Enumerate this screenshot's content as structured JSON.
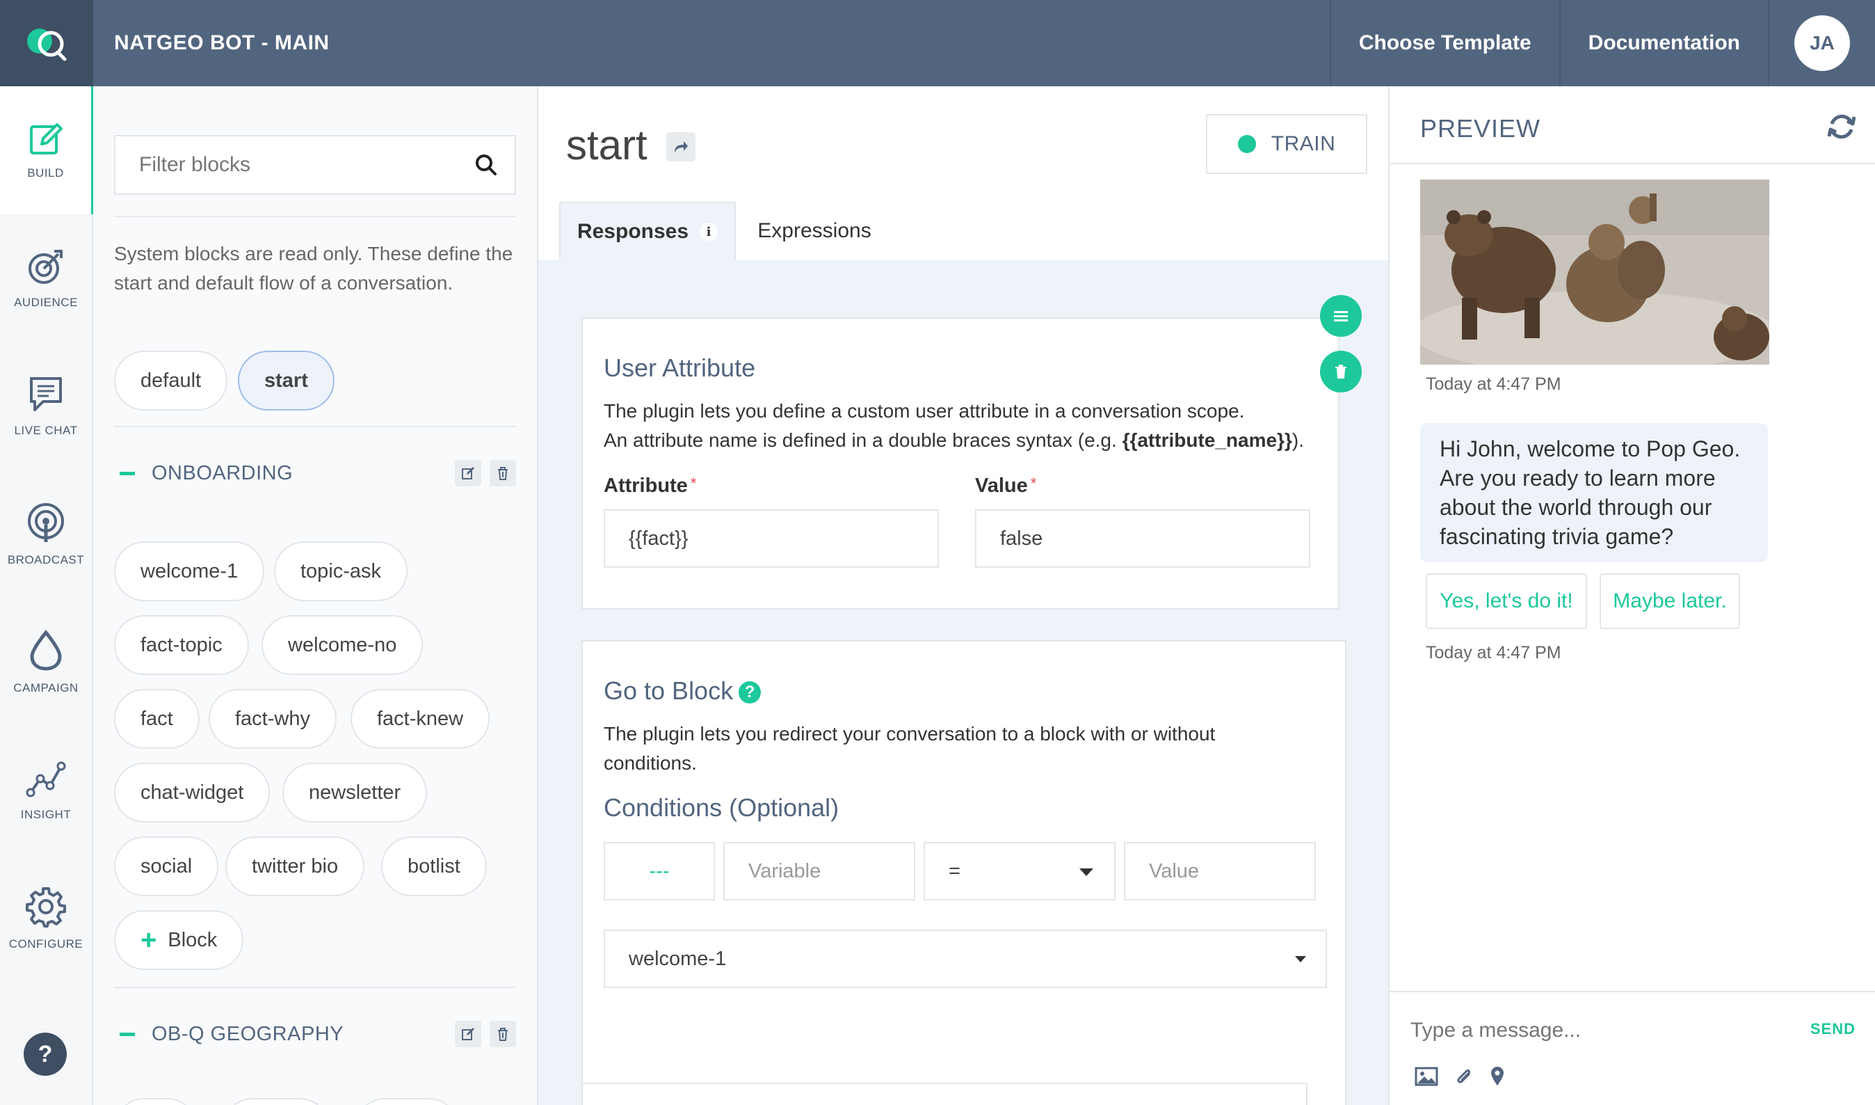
{
  "header": {
    "app_title": "NATGEO BOT - MAIN",
    "choose_template": "Choose Template",
    "documentation": "Documentation",
    "avatar_initials": "JA"
  },
  "nav": {
    "items": [
      {
        "label": "BUILD",
        "icon": "edit-icon"
      },
      {
        "label": "AUDIENCE",
        "icon": "target-icon"
      },
      {
        "label": "LIVE CHAT",
        "icon": "chat-icon"
      },
      {
        "label": "BROADCAST",
        "icon": "broadcast-icon"
      },
      {
        "label": "CAMPAIGN",
        "icon": "drop-icon"
      },
      {
        "label": "INSIGHT",
        "icon": "chart-line-icon"
      },
      {
        "label": "CONFIGURE",
        "icon": "gear-icon"
      }
    ],
    "help": "?"
  },
  "blocks": {
    "filter_placeholder": "Filter blocks",
    "system_text": "System blocks are read only. These define the start and default flow of a conversation.",
    "system_blocks": [
      "default",
      "start"
    ],
    "selected_block": "start",
    "groups": [
      {
        "name": "ONBOARDING",
        "blocks": [
          "welcome-1",
          "topic-ask",
          "fact-topic",
          "welcome-no",
          "fact",
          "fact-why",
          "fact-knew",
          "chat-widget",
          "newsletter",
          "social",
          "twitter bio",
          "botlist"
        ]
      },
      {
        "name": "OB-Q GEOGRAPHY",
        "blocks": []
      }
    ],
    "add_block_label": "Block"
  },
  "editor": {
    "title": "start",
    "train_label": "TRAIN",
    "tabs": [
      "Responses",
      "Expressions"
    ],
    "info_glyph": "i",
    "user_attribute": {
      "title": "User Attribute",
      "desc_line1": "The plugin lets you define a custom user attribute in a conversation scope.",
      "desc_line2_prefix": "An attribute name is defined in a double braces syntax (e.g. ",
      "desc_line2_code": "{{attribute_name}}",
      "desc_line2_suffix": ").",
      "attribute_label": "Attribute",
      "value_label": "Value",
      "required_mark": "*",
      "attribute_value": "{{fact}}",
      "value_value": "false"
    },
    "goto_block": {
      "title": "Go to Block",
      "help_glyph": "?",
      "desc": "The plugin lets you redirect your conversation to a block with or without conditions.",
      "conditions_label": "Conditions (Optional)",
      "condition_dash": "---",
      "variable_placeholder": "Variable",
      "operator": "=",
      "value_placeholder": "Value",
      "target_block": "welcome-1"
    }
  },
  "preview": {
    "title": "PREVIEW",
    "timestamp1": "Today at 4:47 PM",
    "message": "Hi John, welcome to Pop Geo. Are you ready to learn more about the world through our fascinating trivia game?",
    "quick_replies": [
      "Yes, let's do it!",
      "Maybe later."
    ],
    "timestamp2": "Today at 4:47 PM",
    "input_placeholder": "Type a message...",
    "send_label": "SEND"
  },
  "colors": {
    "accent": "#1dc89b",
    "topbar": "#52657f",
    "topbar_dark": "#3e4e63"
  }
}
